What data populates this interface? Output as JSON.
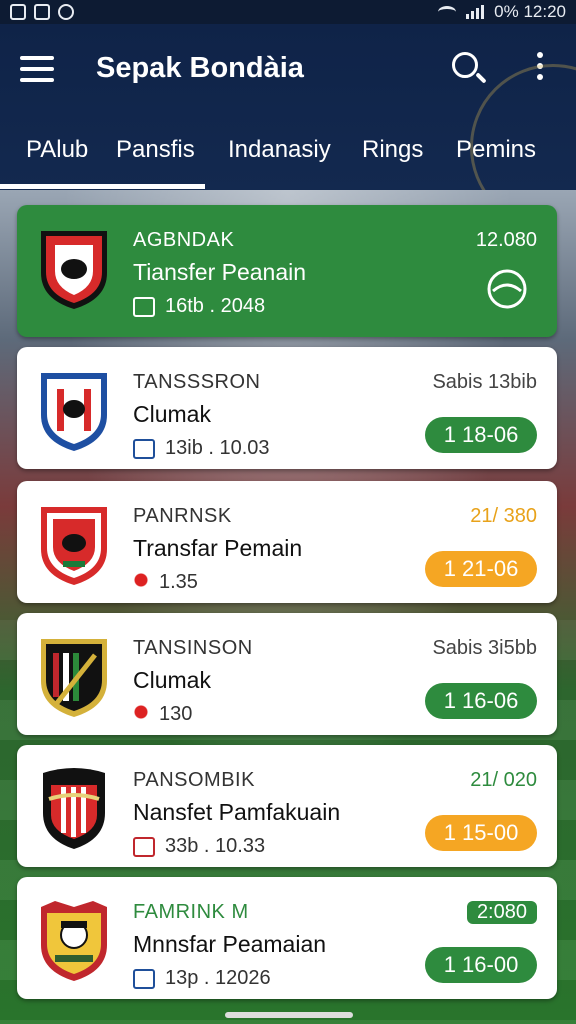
{
  "status_bar": {
    "right_text": "0% 12:20"
  },
  "app_bar": {
    "title": "Sepak Bondàia"
  },
  "tabs": [
    {
      "label": "PAlub"
    },
    {
      "label": "Pansfis"
    },
    {
      "label": "Indanasiy"
    },
    {
      "label": "Rings"
    },
    {
      "label": "Pemins"
    }
  ],
  "cards": [
    {
      "title": "AGBNDAK",
      "subtitle": "Tiansfer Peanain",
      "meta": "16tb . 2048",
      "right": "12.080",
      "badge": "",
      "badge_color": "",
      "crest_colors": [
        "#d72a2a",
        "#ffffff",
        "#111111"
      ]
    },
    {
      "title": "TANSSSRON",
      "subtitle": "Clumak",
      "meta": "13ib . 10.03",
      "right": "Sabis 13bib",
      "badge": "1 18-06",
      "badge_color": "#2e8b3e",
      "crest_colors": [
        "#1e4fa2",
        "#d72a2a",
        "#ffffff"
      ]
    },
    {
      "title": "PANRNSK",
      "subtitle": "Transfar Pemain",
      "meta": "1.35",
      "right": "21/ 380",
      "badge": "1 21-06",
      "badge_color": "#f5a623",
      "crest_colors": [
        "#d72a2a",
        "#ffffff",
        "#1a7a3a"
      ]
    },
    {
      "title": "TANSINSON",
      "subtitle": "Clumak",
      "meta": "130",
      "right": "Sabis 3i5bb",
      "badge": "1 16-06",
      "badge_color": "#2e8b3e",
      "crest_colors": [
        "#111111",
        "#d4b13a",
        "#c0272d"
      ]
    },
    {
      "title": "PANSOMBIK",
      "subtitle": "Nansfet Pamfakuain",
      "meta": "33b . 10.33",
      "right": "21/ 020",
      "badge": "1 15-00",
      "badge_color": "#f5a623",
      "crest_colors": [
        "#111111",
        "#d72a2a",
        "#e8d27a"
      ]
    },
    {
      "title": "FAMRINK M",
      "subtitle": "Mnnsfar Peamaian",
      "meta": "13p . 12026",
      "right": "2:080",
      "badge": "1 16-00",
      "badge_color": "#2e8b3e",
      "crest_colors": [
        "#c0272d",
        "#f0c63b",
        "#2f5e2f"
      ]
    }
  ]
}
